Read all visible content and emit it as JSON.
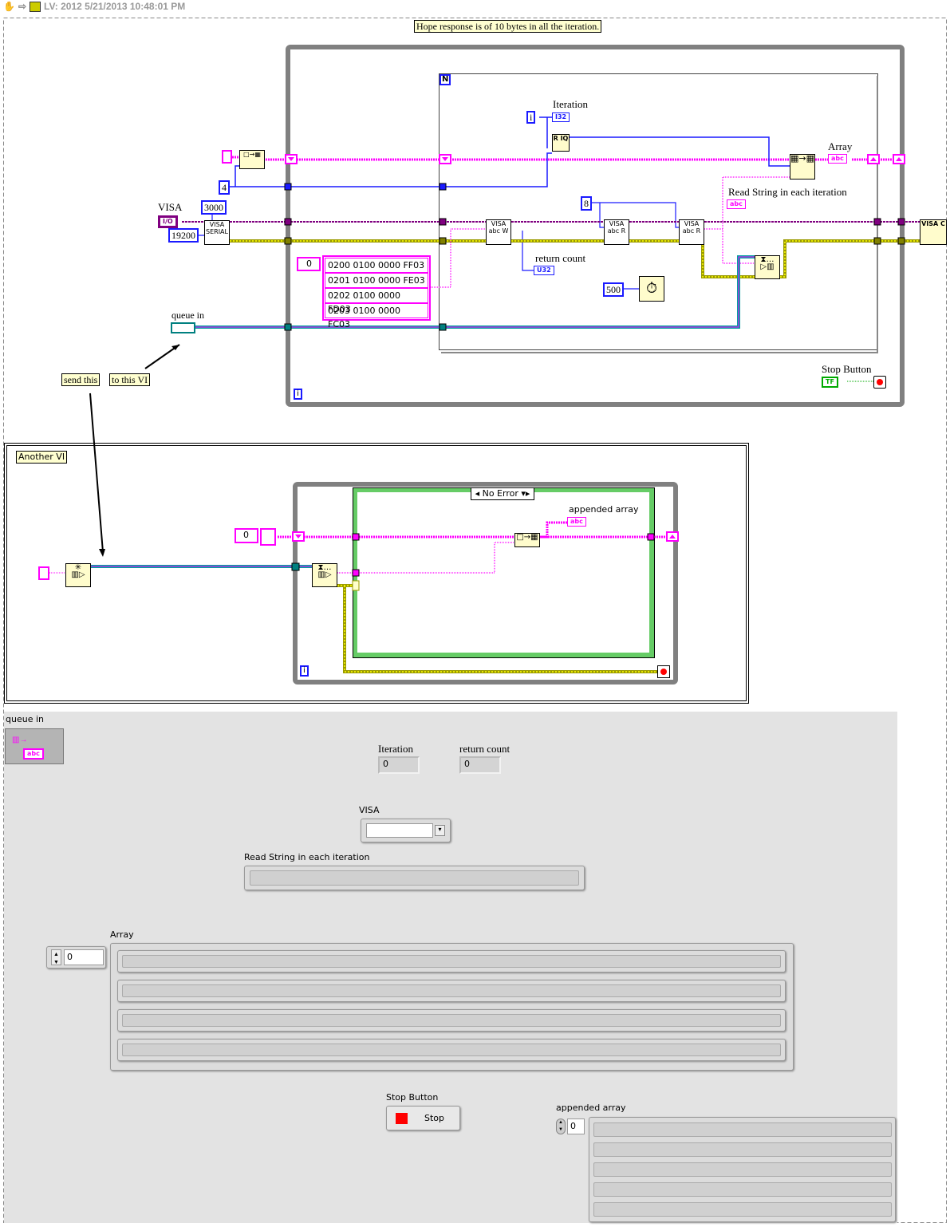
{
  "header": {
    "title": "LV: 2012 5/21/2013 10:48:01 PM",
    "icons": [
      "hand-tool-icon",
      "run-arrow-icon",
      "vi-icon"
    ]
  },
  "diagram": {
    "comment": "Hope response is of 10 bytes in all the iteration.",
    "for_loop_count_terminal": "N",
    "while_iteration_terminal": "i",
    "for_iteration_terminal": "i",
    "constants": {
      "four": "4",
      "timeout": "3000",
      "baud": "19200",
      "bytes_to_read": "8",
      "wait_ms": "500"
    },
    "visa_label": "VISA",
    "visa_control": "I/O",
    "iteration_label": "Iteration",
    "iteration_type": "I32",
    "return_count_label": "return count",
    "return_count_type": "U32",
    "array_label": "Array",
    "array_type": "abc",
    "read_string_label": "Read String in each iteration",
    "read_string_type": "abc",
    "array_constant": {
      "index": "0",
      "items": [
        "0200 0100 0000 FF03",
        "0201 0100 0000 FE03",
        "0202 0100 0000 FD03",
        "0203 0100 0000 FC03"
      ]
    },
    "queue_in_label": "queue in",
    "stop_button_label": "Stop Button",
    "stop_button_type": "TF",
    "nodes": {
      "visa_serial": "VISA SERIAL",
      "visa_write": "VISA abc W",
      "visa_read": "VISA abc R",
      "visa_close": "VISA C",
      "quotient": "R IQ"
    },
    "send_this": "send this",
    "to_this_vi": "to this VI",
    "another_vi": {
      "label": "Another VI",
      "case_selector": "No Error",
      "array_const_index": "0",
      "appended_array_label": "appended array",
      "appended_array_type": "abc",
      "iteration_terminal": "i"
    }
  },
  "front_panel": {
    "queue_in_label": "queue in",
    "queue_type": "abc",
    "iteration": {
      "label": "Iteration",
      "value": "0"
    },
    "return_count": {
      "label": "return count",
      "value": "0"
    },
    "visa": {
      "label": "VISA",
      "value": ""
    },
    "read_string": {
      "label": "Read String in each iteration",
      "value": ""
    },
    "array": {
      "label": "Array",
      "index": "0",
      "items": [
        "",
        "",
        "",
        ""
      ]
    },
    "stop_button": {
      "label": "Stop Button",
      "text": "Stop",
      "led_color": "#ff0000"
    },
    "appended_array": {
      "label": "appended array",
      "index": "0",
      "items": [
        "",
        "",
        "",
        "",
        ""
      ]
    }
  },
  "colors": {
    "string_wire": "#ff00ff",
    "int_wire": "#1a1aff",
    "visa_wire": "#800080",
    "error_wire": "#c8c800",
    "queue_wire": "#00a0a0",
    "loop_border": "#808080",
    "case_border": "#66cc66"
  }
}
